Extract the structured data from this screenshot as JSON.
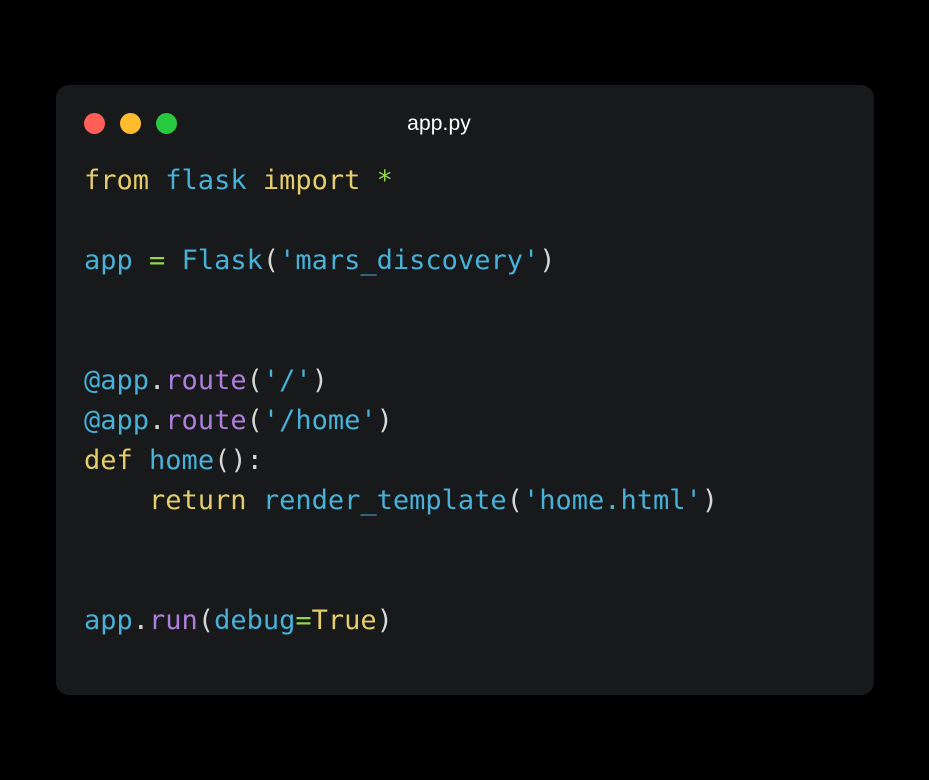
{
  "window": {
    "title": "app.py",
    "background": "#18191b",
    "page_background": "#000000",
    "traffic_lights": [
      {
        "name": "close",
        "color": "#ff5f56"
      },
      {
        "name": "minimize",
        "color": "#ffbd2e"
      },
      {
        "name": "maximize",
        "color": "#27c93f"
      }
    ]
  },
  "editor": {
    "language": "python",
    "palette": {
      "keyword": "#e5cd6b",
      "name": "#49b0d8",
      "string": "#49b0d8",
      "function": "#ae7edc",
      "operator": "#95d44f",
      "punctuation": "#d6d6d6"
    },
    "lines": [
      {
        "n": 1,
        "text": "from flask import *"
      },
      {
        "n": 2,
        "text": ""
      },
      {
        "n": 3,
        "text": "app = Flask('mars_discovery')"
      },
      {
        "n": 4,
        "text": ""
      },
      {
        "n": 5,
        "text": ""
      },
      {
        "n": 6,
        "text": "@app.route('/')"
      },
      {
        "n": 7,
        "text": "@app.route('/home')"
      },
      {
        "n": 8,
        "text": "def home():"
      },
      {
        "n": 9,
        "text": "    return render_template('home.html')"
      },
      {
        "n": 10,
        "text": ""
      },
      {
        "n": 11,
        "text": ""
      },
      {
        "n": 12,
        "text": "app.run(debug=True)"
      }
    ],
    "tokens": {
      "l1_from": "from",
      "l1_sp1": " ",
      "l1_flask": "flask",
      "l1_sp2": " ",
      "l1_import": "import",
      "l1_sp3": " ",
      "l1_star": "*",
      "l3_app": "app",
      "l3_sp1": " ",
      "l3_eq": "=",
      "l3_sp2": " ",
      "l3_flask": "Flask",
      "l3_open": "(",
      "l3_str": "'mars_discovery'",
      "l3_close": ")",
      "l6_at_app": "@app",
      "l6_dot": ".",
      "l6_route": "route",
      "l6_open": "(",
      "l6_str": "'/'",
      "l6_close": ")",
      "l7_at_app": "@app",
      "l7_dot": ".",
      "l7_route": "route",
      "l7_open": "(",
      "l7_str": "'/home'",
      "l7_close": ")",
      "l8_def": "def",
      "l8_sp1": " ",
      "l8_home": "home",
      "l8_parens": "():",
      "l9_indent": "    ",
      "l9_return": "return",
      "l9_sp1": " ",
      "l9_render": "render_template",
      "l9_open": "(",
      "l9_str": "'home.html'",
      "l9_close": ")",
      "l12_app": "app",
      "l12_dot": ".",
      "l12_run": "run",
      "l12_open": "(",
      "l12_debug": "debug",
      "l12_eq": "=",
      "l12_true": "True",
      "l12_close": ")"
    }
  }
}
